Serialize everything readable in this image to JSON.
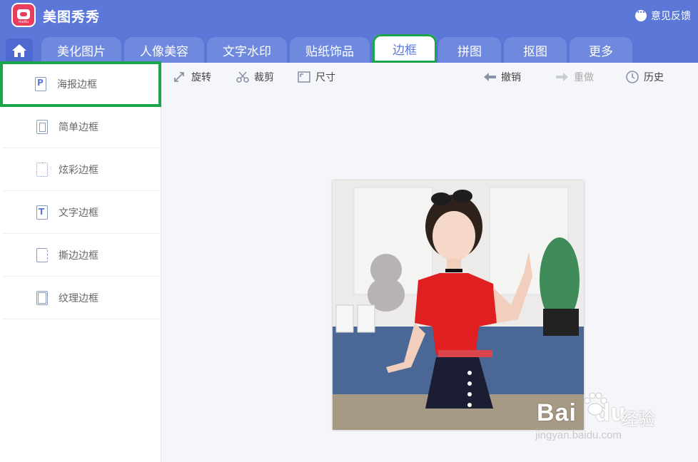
{
  "app": {
    "title": "美图秀秀",
    "logo_text": "meitu",
    "feedback_label": "意见反馈"
  },
  "tabs": [
    {
      "label": "美化图片"
    },
    {
      "label": "人像美容"
    },
    {
      "label": "文字水印"
    },
    {
      "label": "贴纸饰品"
    },
    {
      "label": "边框",
      "active": true
    },
    {
      "label": "拼图"
    },
    {
      "label": "抠图"
    },
    {
      "label": "更多"
    }
  ],
  "sidebar": {
    "items": [
      {
        "label": "海报边框",
        "icon": "poster-frame-icon",
        "selected": true
      },
      {
        "label": "简单边框",
        "icon": "simple-frame-icon"
      },
      {
        "label": "炫彩边框",
        "icon": "colorful-frame-icon"
      },
      {
        "label": "文字边框",
        "icon": "text-frame-icon"
      },
      {
        "label": "撕边边框",
        "icon": "torn-frame-icon"
      },
      {
        "label": "纹理边框",
        "icon": "texture-frame-icon"
      }
    ]
  },
  "toolbar": {
    "rotate": "旋转",
    "crop": "裁剪",
    "size": "尺寸",
    "undo": "撤销",
    "redo": "重做",
    "history": "历史"
  },
  "watermark": {
    "logo": "Bai",
    "logo_du": "du",
    "jingyan": "经验",
    "url": "jingyan.baidu.com"
  },
  "colors": {
    "header": "#5b78d8",
    "tab_inactive": "#6f89de",
    "highlight": "#1aa54a",
    "sidebar_bg": "#ffffff",
    "workspace_bg": "#f5f6fa"
  }
}
